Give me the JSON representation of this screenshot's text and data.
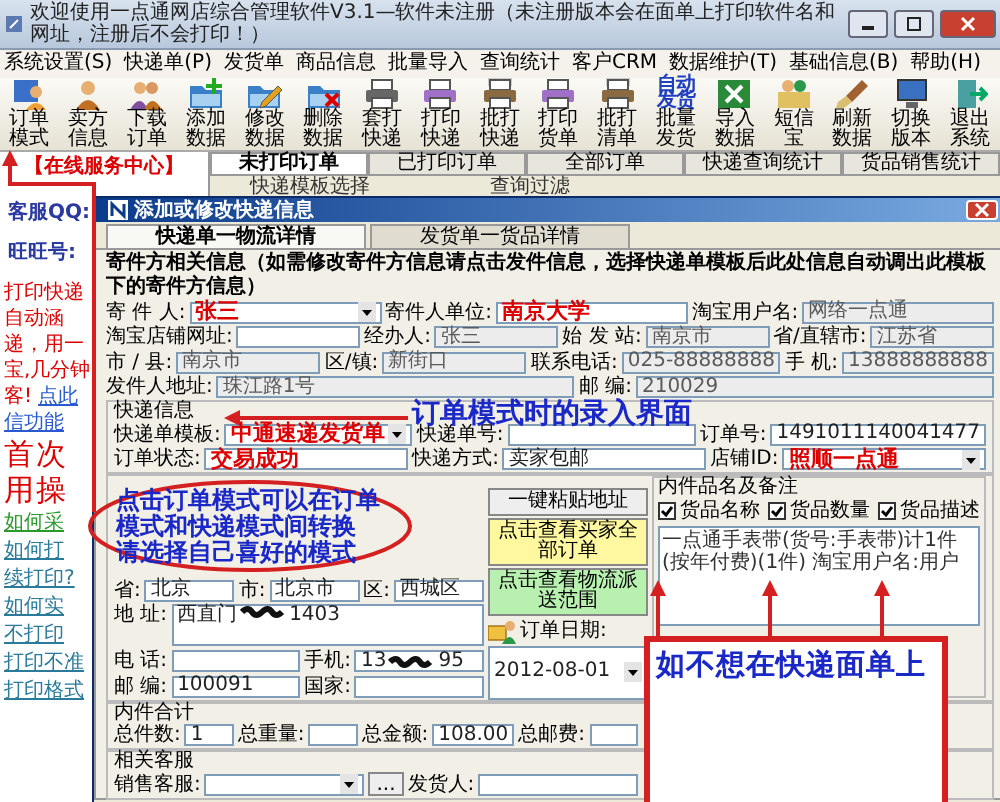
{
  "window": {
    "title": "欢迎使用一点通网店综合管理软件V3.1—软件未注册（未注册版本会在面单上打印软件名和网址，注册后不会打印！）"
  },
  "menu": [
    "系统设置(S)",
    "快递单(P)",
    "发货单",
    "商品信息",
    "批量导入",
    "查询统计",
    "客户CRM",
    "数据维护(T)",
    "基础信息(B)",
    "帮助(H)"
  ],
  "toolbar": [
    {
      "label": "订单模式"
    },
    {
      "label": "卖方信息"
    },
    {
      "label": "下载订单"
    },
    {
      "label": "添加数据"
    },
    {
      "label": "修改数据"
    },
    {
      "label": "删除数据"
    },
    {
      "label": "套打快递"
    },
    {
      "label": "打印快递"
    },
    {
      "label": "批打快递"
    },
    {
      "label": "打印货单"
    },
    {
      "label": "批打清单"
    },
    {
      "label": "批量发货",
      "icon_text": "自动发货"
    },
    {
      "label": "导入数据"
    },
    {
      "label": "短信宝"
    },
    {
      "label": "刷新数据"
    },
    {
      "label": "切换版本"
    },
    {
      "label": "退出系统"
    }
  ],
  "sidebar": {
    "title": "【在线服务中心】",
    "qq_label": "客服QQ:",
    "wangwang_label": "旺旺号:",
    "promo_lines": [
      "打印快递",
      "自动涵",
      "递，用一",
      "宝,几分钟"
    ],
    "promo_end": "客!",
    "promo_link": "点此",
    "promo_link_cont": "信功能",
    "headline": [
      "首次",
      "用操"
    ],
    "help_links": [
      {
        "text": "如何采",
        "color": "#2a9a2a"
      },
      {
        "text": "如何打",
        "color": "#2a7a9a"
      },
      {
        "text": "续打印?",
        "color": "#2a7a9a"
      },
      {
        "text": "如何实",
        "color": "#2a7a9a"
      },
      {
        "text": "不打印",
        "color": "#2a7a9a"
      },
      {
        "text": "打印不准",
        "color": "#2a7a9a"
      },
      {
        "text": "打印格式",
        "color": "#2a7a9a"
      }
    ]
  },
  "tabs": [
    {
      "label": "未打印订单",
      "selected": true
    },
    {
      "label": "已打印订单",
      "selected": false
    },
    {
      "label": "全部订单",
      "selected": false
    },
    {
      "label": "快递查询统计",
      "selected": false
    },
    {
      "label": "货品销售统计",
      "selected": false
    }
  ],
  "filters": [
    "快递模板选择",
    "查询过滤"
  ],
  "dialog": {
    "title": "添加或修改快递信息",
    "tabs": [
      {
        "label": "快递单一物流详情",
        "selected": true
      },
      {
        "label": "发货单一货品详情",
        "selected": false
      }
    ],
    "sender_note": "寄件方相关信息（如需修改寄件方信息请点击发件信息，选择快递单模板后此处信息自动调出此模板下的寄件方信息）",
    "sender_rows": [
      [
        {
          "label": "寄 件 人:",
          "value": "张三",
          "kind": "combo",
          "emphasized": true,
          "disabled": false
        },
        {
          "label": "寄件人单位:",
          "value": "南京大学",
          "kind": "text",
          "emphasized": true,
          "disabled": false
        },
        {
          "label": "淘宝用户名:",
          "value": "网络一点通",
          "kind": "text",
          "emphasized": false,
          "disabled": true
        }
      ],
      [
        {
          "label": "淘宝店铺网址:",
          "kind": "text",
          "disabled": false
        },
        {
          "label": "经办人:",
          "value": "张三",
          "kind": "text",
          "emphasized": false,
          "disabled": true
        },
        {
          "label": "始 发 站:",
          "value": "南京市",
          "kind": "text",
          "emphasized": false,
          "disabled": true
        },
        {
          "label": "省/直辖市:",
          "value": "江苏省",
          "kind": "text",
          "emphasized": false,
          "disabled": true
        }
      ],
      [
        {
          "label": "市 / 县:",
          "value": "南京市",
          "kind": "text",
          "emphasized": false,
          "disabled": true
        },
        {
          "label": "区/镇:",
          "value": "新街口",
          "kind": "text",
          "emphasized": false,
          "disabled": true
        },
        {
          "label": "联系电话:",
          "value": "025-88888888",
          "kind": "text",
          "emphasized": false,
          "disabled": true
        },
        {
          "label": "手 机:",
          "value": "13888888888",
          "kind": "text",
          "emphasized": false,
          "disabled": true
        }
      ],
      [
        {
          "label": "发件人地址:",
          "value": "珠江路1号",
          "kind": "text",
          "emphasized": false,
          "disabled": true
        },
        {
          "label": "邮 编:",
          "value": "210029",
          "kind": "text",
          "emphasized": false,
          "disabled": true
        }
      ]
    ],
    "express_title": "快递信息",
    "express_rows": [
      [
        {
          "label": "快递单模板:",
          "value": "中通速递发货单",
          "kind": "combo",
          "emphasized": true,
          "disabled": false
        },
        {
          "label": "快递单号:",
          "kind": "text",
          "disabled": false
        },
        {
          "label": "订单号:",
          "value": "1491011140041477",
          "kind": "text",
          "emphasized": false,
          "disabled": false
        }
      ],
      [
        {
          "label": "订单状态:",
          "value": "交易成功",
          "kind": "text",
          "emphasized": true,
          "disabled": false
        },
        {
          "label": "快递方式:",
          "value": "卖家包邮",
          "kind": "text",
          "emphasized": false,
          "disabled": false
        },
        {
          "label": "店铺ID:",
          "value": "照顺一点通",
          "kind": "combo",
          "emphasized": true,
          "disabled": false
        }
      ]
    ],
    "recipient_rows": [
      [
        {
          "label": "省:",
          "value": "北京",
          "kind": "text",
          "emphasized": false,
          "disabled": false
        },
        {
          "label": "市:",
          "value": "北京市",
          "kind": "text",
          "emphasized": false,
          "disabled": false
        },
        {
          "label": "区:",
          "value": "西城区",
          "kind": "text",
          "emphasized": false,
          "disabled": false
        }
      ],
      [
        {
          "label": "地 址:",
          "value_parts": [
            "西直门",
            "1403"
          ],
          "kind": "area",
          "emphasized": false,
          "disabled": false
        }
      ],
      [
        {
          "label": "电 话:",
          "kind": "text",
          "disabled": false
        },
        {
          "label": "手机:",
          "value_parts": [
            "13",
            "95"
          ],
          "kind": "text",
          "emphasized": false,
          "disabled": false
        }
      ],
      [
        {
          "label": "邮 编:",
          "value": "100091",
          "kind": "text",
          "emphasized": false,
          "disabled": false
        },
        {
          "label": "国家:",
          "kind": "text",
          "disabled": false
        }
      ]
    ],
    "paste_button": "一键粘贴地址",
    "orders_button": "点击查看买家全部订单",
    "range_button": "点击查看物流派送范围",
    "date": {
      "label": "订单日期:",
      "value": "2012-08-01"
    },
    "notes": {
      "title": "内件品名及备注",
      "options": [
        {
          "label": "货品名称",
          "checked": true
        },
        {
          "label": "货品数量",
          "checked": true
        },
        {
          "label": "货品描述",
          "checked": true
        }
      ],
      "text": "一点通手表带(货号:手表带)计1件(按年付费)(1件) 淘宝用户名:用户"
    },
    "totals_title": "内件合计",
    "totals": [
      {
        "label": "总件数:",
        "value": "1",
        "kind": "text",
        "emphasized": false,
        "disabled": false
      },
      {
        "label": "总重量:",
        "kind": "text",
        "disabled": false
      },
      {
        "label": "总金额:",
        "value": "108.00",
        "kind": "text",
        "emphasized": false,
        "disabled": false
      },
      {
        "label": "总邮费:",
        "kind": "text",
        "disabled": false
      }
    ],
    "staff_title": "相关客服",
    "staff": {
      "sales_label": "销售客服:",
      "more_button": "...",
      "sender_label": "发货人:"
    }
  },
  "annotations": {
    "mode_note": "订单模式时的录入界面",
    "tip_lines": [
      "点击订单模式可以在订单",
      "模式和快递模式间转换",
      "请选择自己喜好的模式"
    ],
    "box_lines": [
      "如不想在快递面单上"
    ]
  }
}
